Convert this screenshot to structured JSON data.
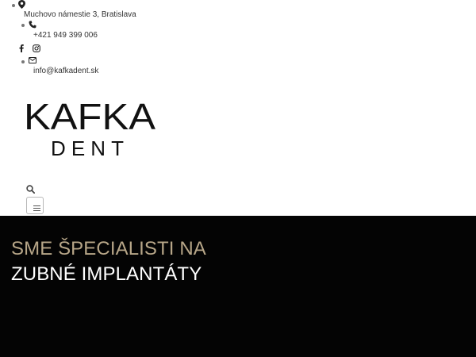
{
  "contact": {
    "address": "Muchovo námestie 3, Bratislava",
    "phone": "+421 949 399 006",
    "email": "info@kafkadent.sk",
    "icons": {
      "address": "map-pin-icon",
      "phone": "phone-icon",
      "social": [
        "facebook-icon",
        "instagram-icon"
      ],
      "email": "envelope-icon"
    }
  },
  "logo": {
    "line1": "KAFKA",
    "line2": "DENT",
    "color": "#111111"
  },
  "header": {
    "search_icon": "search-icon",
    "menu_icon": "hamburger-menu-icon"
  },
  "hero": {
    "line1": "SME ŠPECIALISTI NA",
    "line2": "ZUBNÉ IMPLANTÁTY",
    "accent_color": "#b7a688",
    "background": "#040404"
  }
}
